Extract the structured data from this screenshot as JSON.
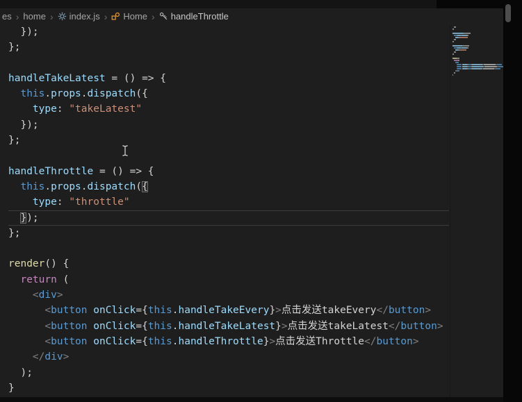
{
  "breadcrumbs": {
    "separator": "›",
    "items": [
      {
        "label": "es"
      },
      {
        "label": "home"
      },
      {
        "label": "index.js",
        "icon": "gear-icon"
      },
      {
        "label": "Home",
        "icon": "class-symbol-icon"
      },
      {
        "label": "handleThrottle",
        "icon": "property-key-icon"
      }
    ]
  },
  "editor": {
    "language": "javascriptreact",
    "current_line": 12,
    "lines": [
      [
        {
          "t": "  ",
          "c": "ws"
        },
        {
          "t": "});",
          "c": "pun"
        }
      ],
      [
        {
          "t": "};",
          "c": "pun"
        }
      ],
      [],
      [
        {
          "t": "handleTakeLatest",
          "c": "prop"
        },
        {
          "t": " = () => {",
          "c": "pun"
        }
      ],
      [
        {
          "t": "  ",
          "c": "ws"
        },
        {
          "t": "this",
          "c": "kw"
        },
        {
          "t": ".",
          "c": "pun"
        },
        {
          "t": "props",
          "c": "prop"
        },
        {
          "t": ".",
          "c": "pun"
        },
        {
          "t": "dispatch",
          "c": "prop"
        },
        {
          "t": "({",
          "c": "pun"
        }
      ],
      [
        {
          "t": "    ",
          "c": "ws"
        },
        {
          "t": "type",
          "c": "prop"
        },
        {
          "t": ": ",
          "c": "pun"
        },
        {
          "t": "\"takeLatest\"",
          "c": "str"
        }
      ],
      [
        {
          "t": "  ",
          "c": "ws"
        },
        {
          "t": "});",
          "c": "pun"
        }
      ],
      [
        {
          "t": "};",
          "c": "pun"
        }
      ],
      [],
      [
        {
          "t": "handleThrottle",
          "c": "prop"
        },
        {
          "t": " = () => {",
          "c": "pun"
        }
      ],
      [
        {
          "t": "  ",
          "c": "ws"
        },
        {
          "t": "this",
          "c": "kw"
        },
        {
          "t": ".",
          "c": "pun"
        },
        {
          "t": "props",
          "c": "prop"
        },
        {
          "t": ".",
          "c": "pun"
        },
        {
          "t": "dispatch",
          "c": "prop"
        },
        {
          "t": "(",
          "c": "pun"
        },
        {
          "t": "{",
          "c": "pun",
          "m": true
        }
      ],
      [
        {
          "t": "    ",
          "c": "ws"
        },
        {
          "t": "type",
          "c": "prop"
        },
        {
          "t": ": ",
          "c": "pun"
        },
        {
          "t": "\"throttle\"",
          "c": "str"
        }
      ],
      [
        {
          "t": "  ",
          "c": "ws"
        },
        {
          "t": "}",
          "c": "pun",
          "m": true
        },
        {
          "t": ");",
          "c": "pun"
        }
      ],
      [
        {
          "t": "};",
          "c": "pun"
        }
      ],
      [],
      [
        {
          "t": "render",
          "c": "fn"
        },
        {
          "t": "() {",
          "c": "pun"
        }
      ],
      [
        {
          "t": "  ",
          "c": "ws"
        },
        {
          "t": "return",
          "c": "ctrl"
        },
        {
          "t": " (",
          "c": "pun"
        }
      ],
      [
        {
          "t": "    ",
          "c": "ws"
        },
        {
          "t": "<",
          "c": "tagp"
        },
        {
          "t": "div",
          "c": "tag"
        },
        {
          "t": ">",
          "c": "tagp"
        }
      ],
      [
        {
          "t": "      ",
          "c": "ws"
        },
        {
          "t": "<",
          "c": "tagp"
        },
        {
          "t": "button",
          "c": "tag"
        },
        {
          "t": " ",
          "c": "ws"
        },
        {
          "t": "onClick",
          "c": "attr"
        },
        {
          "t": "={",
          "c": "pun"
        },
        {
          "t": "this",
          "c": "kw"
        },
        {
          "t": ".",
          "c": "pun"
        },
        {
          "t": "handleTakeEvery",
          "c": "prop"
        },
        {
          "t": "}",
          "c": "pun"
        },
        {
          "t": ">",
          "c": "tagp"
        },
        {
          "t": "点击发送takeEvery",
          "c": "txt"
        },
        {
          "t": "</",
          "c": "tagp"
        },
        {
          "t": "button",
          "c": "tag"
        },
        {
          "t": ">",
          "c": "tagp"
        }
      ],
      [
        {
          "t": "      ",
          "c": "ws"
        },
        {
          "t": "<",
          "c": "tagp"
        },
        {
          "t": "button",
          "c": "tag"
        },
        {
          "t": " ",
          "c": "ws"
        },
        {
          "t": "onClick",
          "c": "attr"
        },
        {
          "t": "={",
          "c": "pun"
        },
        {
          "t": "this",
          "c": "kw"
        },
        {
          "t": ".",
          "c": "pun"
        },
        {
          "t": "handleTakeLatest",
          "c": "prop"
        },
        {
          "t": "}",
          "c": "pun"
        },
        {
          "t": ">",
          "c": "tagp"
        },
        {
          "t": "点击发送takeLatest",
          "c": "txt"
        },
        {
          "t": "</",
          "c": "tagp"
        },
        {
          "t": "button",
          "c": "tag"
        },
        {
          "t": ">",
          "c": "tagp"
        }
      ],
      [
        {
          "t": "      ",
          "c": "ws"
        },
        {
          "t": "<",
          "c": "tagp"
        },
        {
          "t": "button",
          "c": "tag"
        },
        {
          "t": " ",
          "c": "ws"
        },
        {
          "t": "onClick",
          "c": "attr"
        },
        {
          "t": "={",
          "c": "pun"
        },
        {
          "t": "this",
          "c": "kw"
        },
        {
          "t": ".",
          "c": "pun"
        },
        {
          "t": "handleThrottle",
          "c": "prop"
        },
        {
          "t": "}",
          "c": "pun"
        },
        {
          "t": ">",
          "c": "tagp"
        },
        {
          "t": "点击发送Throttle",
          "c": "txt"
        },
        {
          "t": "</",
          "c": "tagp"
        },
        {
          "t": "button",
          "c": "tag"
        },
        {
          "t": ">",
          "c": "tagp"
        }
      ],
      [
        {
          "t": "    ",
          "c": "ws"
        },
        {
          "t": "</",
          "c": "tagp"
        },
        {
          "t": "div",
          "c": "tag"
        },
        {
          "t": ">",
          "c": "tagp"
        }
      ],
      [
        {
          "t": "  ",
          "c": "ws"
        },
        {
          "t": ");",
          "c": "pun"
        }
      ],
      [
        {
          "t": "}",
          "c": "pun"
        }
      ]
    ]
  },
  "colors": {
    "editor_bg": "#1e1e1e",
    "keyword": "#569cd6",
    "property": "#9cdcfe",
    "string": "#ce9178",
    "function": "#dcdcaa",
    "control": "#c586c0",
    "tag_bracket": "#808080",
    "default_text": "#d4d4d4"
  }
}
